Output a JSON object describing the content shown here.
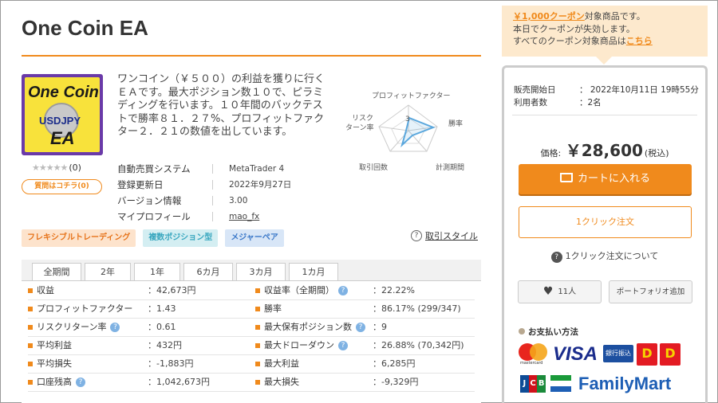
{
  "product": {
    "title": "One Coin EA",
    "image": {
      "line1": "One Coin",
      "line2": "USDJPY",
      "line3": "EA"
    },
    "stars": "★★★★★",
    "review_count": "(0)",
    "review_button": "質問はコチラ(0)",
    "description": "ワンコイン（￥５００）の利益を獲りに行くＥＡです。最大ポジション数１０で、ピラミディングを行います。１０年間のバックテストで勝率８１．２７%、プロフィットファクター２．２１の数値を出しています。",
    "radar": {
      "labels": [
        "プロフィットファクター",
        "勝率",
        "計測期間",
        "取引回数",
        "リスク",
        "ターン率"
      ],
      "center_label": "3"
    },
    "info": [
      {
        "key": "自動売買システム",
        "value": "MetaTrader 4"
      },
      {
        "key": "登録更新日",
        "value": "2022年9月27日"
      },
      {
        "key": "バージョン情報",
        "value": "3.00"
      },
      {
        "key": "マイプロフィール",
        "value": "mao_fx"
      }
    ],
    "tags": [
      "フレキシブルトレーディング",
      "複数ポジション型",
      "メジャーペア"
    ],
    "style_link": "取引スタイル"
  },
  "tabs": [
    "全期間",
    "2年",
    "1年",
    "6カ月",
    "3カ月",
    "1カ月"
  ],
  "stats_left": [
    {
      "label": "収益",
      "value": "：42,673円",
      "help": false
    },
    {
      "label": "プロフィットファクター",
      "value": "：1.43",
      "help": false
    },
    {
      "label": "リスクリターン率",
      "value": "：0.61",
      "help": true
    },
    {
      "label": "平均利益",
      "value": "：432円",
      "help": false
    },
    {
      "label": "平均損失",
      "value": "：-1,883円",
      "help": false
    },
    {
      "label": "口座残高",
      "value": "：1,042,673円",
      "help": true
    }
  ],
  "stats_right": [
    {
      "label": "収益率（全期間）",
      "value": "：22.22%",
      "help": true
    },
    {
      "label": "勝率",
      "value": "：86.17% (299/347)",
      "help": false
    },
    {
      "label": "最大保有ポジション数",
      "value": "：9",
      "help": true
    },
    {
      "label": "最大ドローダウン",
      "value": "：26.88% (70,342円)",
      "help": true
    },
    {
      "label": "最大利益",
      "value": "：6,285円",
      "help": false
    },
    {
      "label": "最大損失",
      "value": "：-9,329円",
      "help": false
    }
  ],
  "coupon": {
    "link1": "￥1,000クーポン",
    "text1": "対象商品です。",
    "line2": "本日でクーポンが失効します。",
    "text3": "すべてのクーポン対象商品は",
    "link3": "こちら"
  },
  "sale": {
    "start_key": "販売開始日",
    "start_value": "：  2022年10月11日 19時55分",
    "users_key": "利用者数",
    "users_value": "：2名",
    "price_label": "価格:",
    "price": "￥28,600",
    "tax": "(税込)",
    "cart_button": "カートに入れる",
    "one_click_button": "1クリック注文",
    "one_click_about": "1クリック注文について",
    "like_count": "11人",
    "portfolio_button": "ポートフォリオ追加",
    "payment_title": "お支払い方法",
    "payment": {
      "mastercard": "mastercard",
      "visa": "VISA",
      "bank": "銀行振込",
      "d1": "D",
      "d2": "D",
      "jcb": [
        "J",
        "C",
        "B"
      ],
      "familymart": "FamilyMart"
    }
  },
  "colors": {
    "accent": "#f08a1c",
    "coupon_bg": "#fde9cd",
    "radar": "#5aa7dd"
  }
}
